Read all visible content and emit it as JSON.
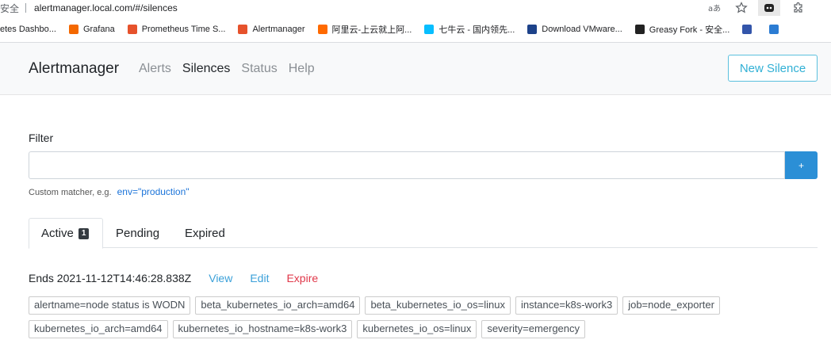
{
  "browser": {
    "security_label": "安全",
    "url": "alertmanager.local.com/#/silences",
    "bookmarks": [
      {
        "label": "etes Dashbo...",
        "icon": "none",
        "color": ""
      },
      {
        "label": "Grafana",
        "icon": "grafana-icon",
        "color": "#f46800"
      },
      {
        "label": "Prometheus Time S...",
        "icon": "prometheus-icon",
        "color": "#e6522c"
      },
      {
        "label": "Alertmanager",
        "icon": "prometheus-icon",
        "color": "#e6522c"
      },
      {
        "label": "阿里云-上云就上阿...",
        "icon": "aliyun-icon",
        "color": "#ff6a00"
      },
      {
        "label": "七牛云 - 国内领先...",
        "icon": "qiniu-icon",
        "color": "#07beff"
      },
      {
        "label": "Download VMware...",
        "icon": "vmware-icon",
        "color": "#1d428a"
      },
      {
        "label": "Greasy Fork - 安全...",
        "icon": "greasyfork-icon",
        "color": "#222"
      },
      {
        "label": "",
        "icon": "globe-icon",
        "color": "#3355aa"
      },
      {
        "label": "",
        "icon": "grid-icon",
        "color": "#2b7cd3"
      }
    ]
  },
  "navbar": {
    "brand": "Alertmanager",
    "links": [
      "Alerts",
      "Silences",
      "Status",
      "Help"
    ],
    "active_link": "Silences",
    "new_silence_label": "New Silence"
  },
  "filter": {
    "label": "Filter",
    "value": "",
    "add_label": "+",
    "hint_text": "Custom matcher, e.g.",
    "hint_example": "env=\"production\""
  },
  "tabs": {
    "active_label": "Active",
    "active_count": "1",
    "pending_label": "Pending",
    "expired_label": "Expired"
  },
  "silence": {
    "ends": "Ends 2021-11-12T14:46:28.838Z",
    "view_label": "View",
    "edit_label": "Edit",
    "expire_label": "Expire",
    "matchers_row1": [
      "alertname=node status is WODN",
      "beta_kubernetes_io_arch=amd64",
      "beta_kubernetes_io_os=linux",
      "instance=k8s-work3",
      "job=node_exporter"
    ],
    "matchers_row2": [
      "kubernetes_io_arch=amd64",
      "kubernetes_io_hostname=k8s-work3",
      "kubernetes_io_os=linux",
      "severity=emergency"
    ]
  },
  "colors": {
    "accent": "#2b8fd6",
    "info_outline": "#5bc0de",
    "danger": "#e0384a"
  }
}
